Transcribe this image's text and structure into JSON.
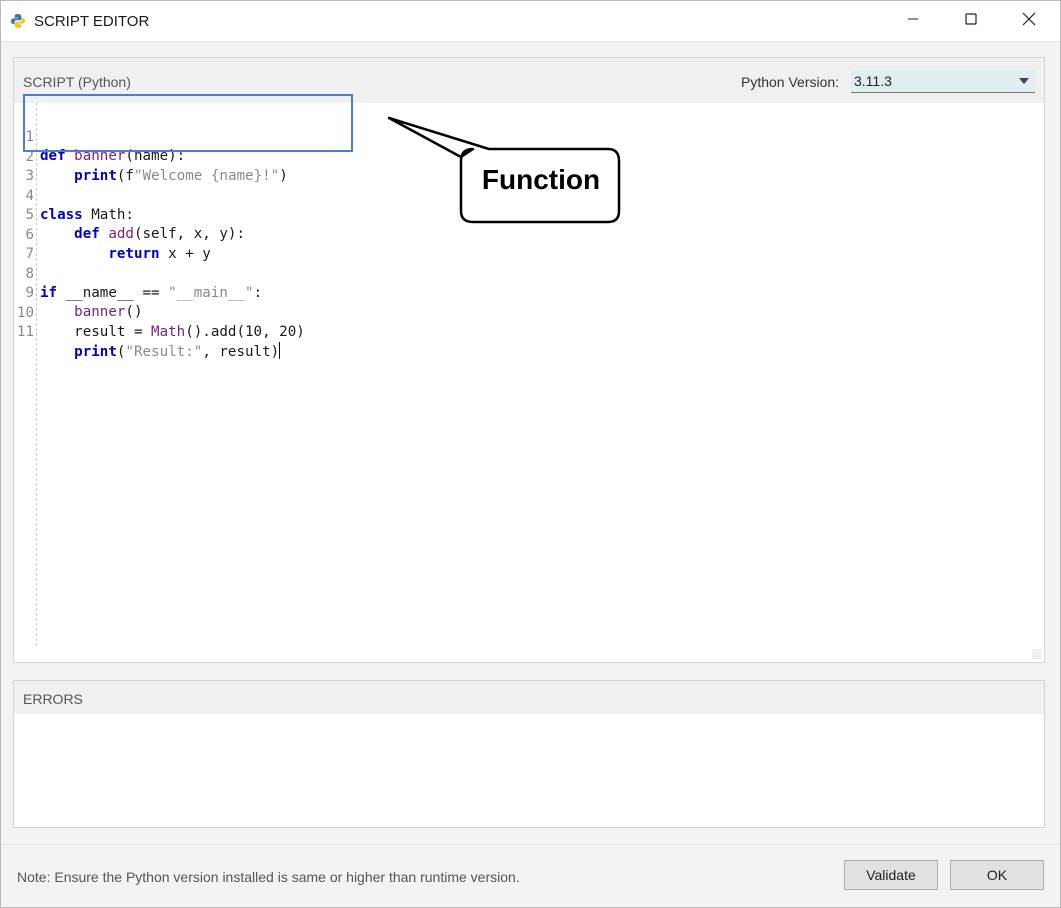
{
  "window": {
    "title": "SCRIPT EDITOR"
  },
  "script_panel": {
    "title": "SCRIPT (Python)",
    "python_version_label": "Python Version:",
    "python_version_value": "3.11.3"
  },
  "editor": {
    "lines": [
      {
        "num": "1",
        "text": "def banner(name):"
      },
      {
        "num": "2",
        "text": "    print(f\"Welcome {name}!\")"
      },
      {
        "num": "3",
        "text": ""
      },
      {
        "num": "4",
        "text": "class Math:"
      },
      {
        "num": "5",
        "text": "    def add(self, x, y):"
      },
      {
        "num": "6",
        "text": "        return x + y"
      },
      {
        "num": "7",
        "text": ""
      },
      {
        "num": "8",
        "text": "if __name__ == \"__main__\":"
      },
      {
        "num": "9",
        "text": "    banner()"
      },
      {
        "num": "10",
        "text": "    result = Math().add(10, 20)"
      },
      {
        "num": "11",
        "text": "    print(\"Result:\", result)"
      }
    ],
    "tokens": {
      "def": "def",
      "banner": "banner",
      "name_args": "(name):",
      "print": "print",
      "fprefix": "(f",
      "welcome_str": "\"Welcome {name}!\"",
      "close_paren": ")",
      "class": "class",
      "math_decl": " Math:",
      "add": "add",
      "add_args": "(self, x, y):",
      "return": "return",
      "return_expr": " x + y",
      "if": "if",
      "main_cond": " __name__ == ",
      "main_str": "\"__main__\"",
      "colon": ":",
      "banner_call": "()",
      "result_assign": "result = ",
      "math_call": "Math",
      "add_call": "().add(10, 20)",
      "open_paren": "(",
      "result_str": "\"Result:\"",
      "result_args": ", result)"
    }
  },
  "annotation": {
    "callout_text": "Function",
    "highlight_color": "#4a7be0"
  },
  "errors_panel": {
    "title": "ERRORS"
  },
  "footer": {
    "note": "Note: Ensure the Python version installed is same or higher than runtime version.",
    "validate_label": "Validate",
    "ok_label": "OK"
  },
  "icons": {
    "app": "python-icon",
    "minimize": "minimize-icon",
    "maximize": "maximize-icon",
    "close": "close-icon",
    "dropdown": "chevron-down-icon"
  }
}
